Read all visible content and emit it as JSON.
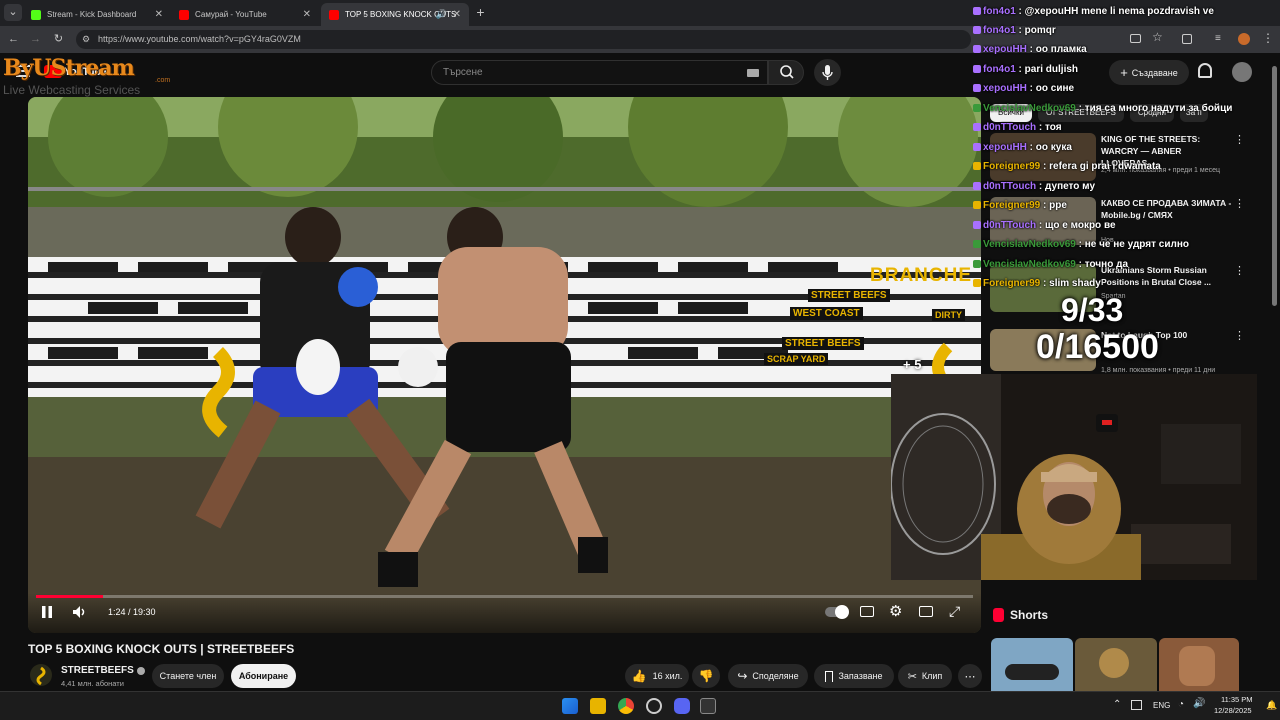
{
  "browser": {
    "tabs": [
      {
        "label": "Stream - Kick Dashboard",
        "icon": "kick-icon",
        "color": "#53fc18"
      },
      {
        "label": "Самурай - YouTube",
        "icon": "youtube-icon",
        "color": "#ff0000"
      },
      {
        "label": "TOP 5 BOXING KNOCK OUTS",
        "icon": "youtube-icon",
        "color": "#ff0000"
      }
    ],
    "url": "https://www.youtube.com/watch?v=pGY4raG0VZM"
  },
  "overlay": {
    "logo_text": "ByUStream",
    "logo_sub": ".com",
    "logo_tagline": "Live Webcasting Services",
    "yt_logo": "YouTube",
    "counter_top": "9/33",
    "counter_bottom": "0/16500"
  },
  "youtube": {
    "search_placeholder": "Търсене",
    "create_label": "Създаване",
    "chips": [
      "Всички",
      "От STREETBEEFS",
      "Сродни",
      "За п"
    ],
    "video": {
      "title": "TOP 5 BOXING KNOCK OUTS | STREETBEEFS",
      "time": "1:24 / 19:30",
      "progress": 0.072,
      "banner": "BRANCHE",
      "wall_signs": [
        "STREET BEEFS",
        "WEST COAST",
        "STREET BEEFS",
        "SCRAP YARD",
        "DIRTY"
      ],
      "plus_badge": "+ 5"
    },
    "channel": {
      "name": "STREETBEEFS",
      "subs": "4,41 млн. абонати",
      "member_label": "Станете член",
      "subscribe_label": "Абониране"
    },
    "actions": {
      "likes": "16 хил.",
      "share": "Споделяне",
      "save": "Запазване",
      "clip": "Клип"
    },
    "recommendations": [
      {
        "title": "KING OF THE STREETS: WARCRY — ABNER LLOVERAS...",
        "meta": "2,4 млн. показвания • преди 1 месец",
        "thumb": "#4a3b2b"
      },
      {
        "title": "КАКВО СЕ ПРОДАВА ЗИМАТА - Mobile.bg / СМЯХ",
        "meta": "Нов",
        "thumb": "#6b6455"
      },
      {
        "title": "Ukrainians Storm Russian Positions in Brutal Close ...",
        "meta": "Spartan",
        "thumb": "#5a6a3a"
      },
      {
        "title": "Not to Laugh Top 100",
        "meta": "1,8 млн. показвания • преди 11 дни",
        "thumb": "#8a7a5a"
      }
    ],
    "shorts_label": "Shorts"
  },
  "chat": [
    {
      "user": "fon4o1",
      "msg": "@xepouHH mene li nema pozdravish ve",
      "color": "#a970ff"
    },
    {
      "user": "fon4o1",
      "msg": "pomqr",
      "color": "#a970ff"
    },
    {
      "user": "xepouHH",
      "msg": "оо пламка",
      "color": "#a970ff"
    },
    {
      "user": "fon4o1",
      "msg": "pari duljish",
      "color": "#a970ff"
    },
    {
      "user": "xepouHH",
      "msg": "оо сине",
      "color": "#a970ff"
    },
    {
      "user": "VencislavNedkov69",
      "msg": "тия са много надути за бойци",
      "color": "#3a9a3a"
    },
    {
      "user": "d0nTTouch",
      "msg": "тоя",
      "color": "#a970ff"
    },
    {
      "user": "xepouHH",
      "msg": "оо кука",
      "color": "#a970ff"
    },
    {
      "user": "Foreigner99",
      "msg": "refera gi prai i dwamata",
      "color": "#e8b400"
    },
    {
      "user": "d0nTTouch",
      "msg": "дупето му",
      "color": "#a970ff"
    },
    {
      "user": "Foreigner99",
      "msg": "ppe",
      "color": "#e8b400"
    },
    {
      "user": "d0nTTouch",
      "msg": "що е мокро ве",
      "color": "#a970ff"
    },
    {
      "user": "VencislavNedkov69",
      "msg": "не че не удрят силно",
      "color": "#3a9a3a"
    },
    {
      "user": "VencislavNedkov69",
      "msg": "точно да",
      "color": "#3a9a3a"
    },
    {
      "user": "Foreigner99",
      "msg": "slim shady",
      "color": "#e8b400"
    }
  ],
  "taskbar": {
    "lang": "ENG",
    "time": "11:35 PM",
    "date": "12/28/2025"
  }
}
